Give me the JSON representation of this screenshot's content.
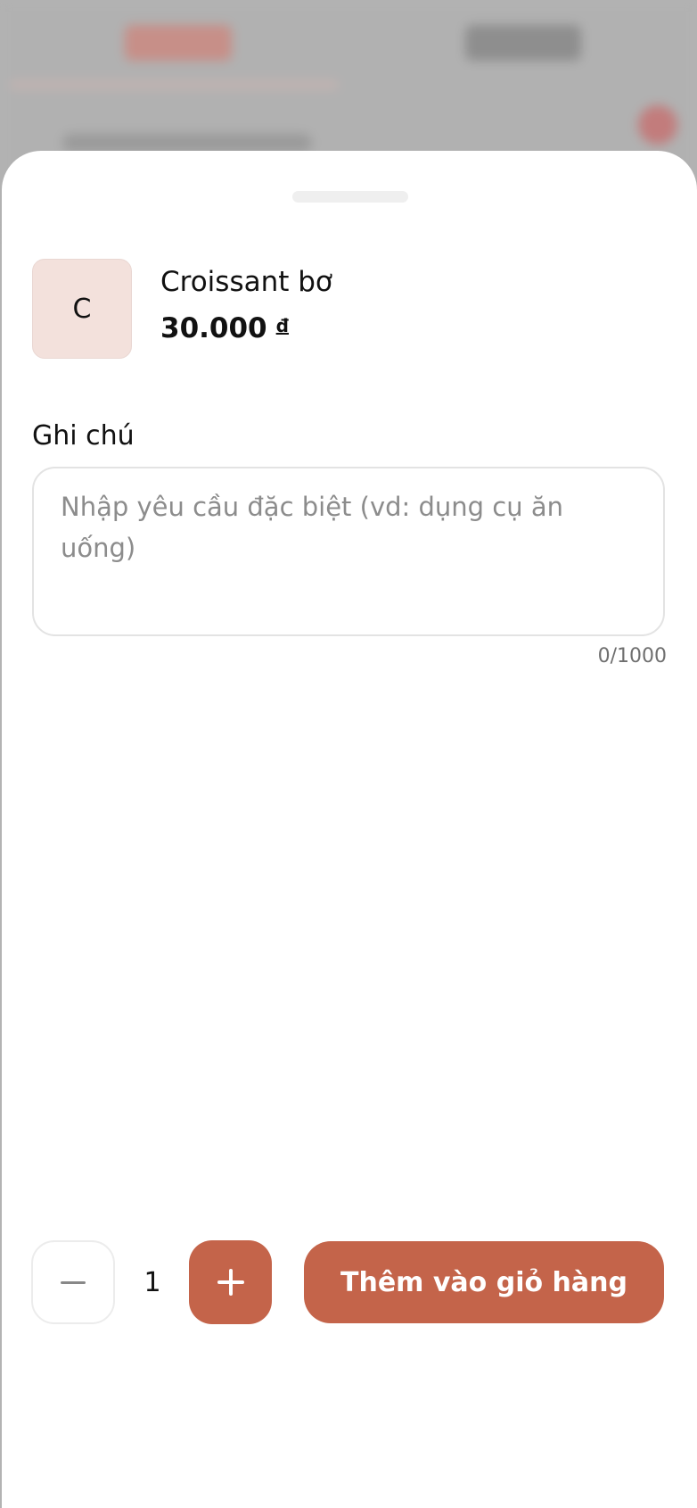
{
  "product": {
    "thumbnail_letter": "C",
    "name": "Croissant bơ",
    "price": "30.000",
    "currency": "đ"
  },
  "note": {
    "label": "Ghi chú",
    "value": "",
    "placeholder": "Nhập yêu cầu đặc biệt (vd: dụng cụ ăn uống)",
    "counter": "0/1000"
  },
  "quantity": {
    "value": "1",
    "decrement_icon": "minus-icon",
    "increment_icon": "plus-icon"
  },
  "actions": {
    "add_to_cart_label": "Thêm vào giỏ hàng"
  },
  "colors": {
    "accent": "#c4644a",
    "thumbnail_bg": "#f3e1dc"
  }
}
